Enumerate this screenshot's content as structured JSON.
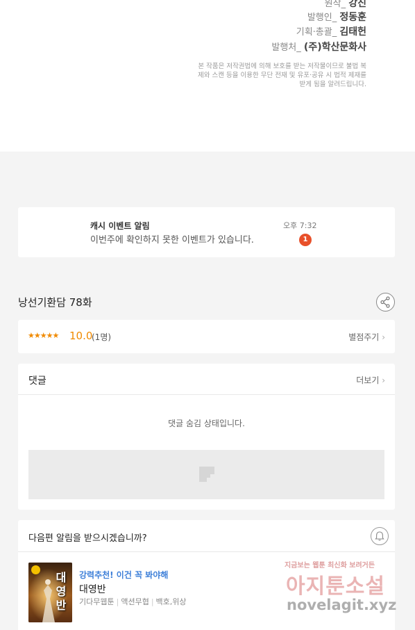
{
  "credits": {
    "items": [
      {
        "label": "원작_",
        "value": "강진"
      },
      {
        "label": "발행인_",
        "value": "정동훈"
      },
      {
        "label": "기획·총괄_",
        "value": "김태헌"
      },
      {
        "label": "발행처_",
        "value": "(주)학산문화사"
      }
    ],
    "notice": "본 작품은 저작권법에 의해 보호를 받는 저작물이므로 불법 복제와 스캔 등을 이용한 무단 전재 및 유포·공유 시 법적 제재를 받게 됨을 알려드립니다."
  },
  "alarm": {
    "title": "캐시 이벤트 알림",
    "message": "이번주에 확인하지 못한 이벤트가 있습니다.",
    "time": "오후 7:32",
    "badge": "1"
  },
  "episode": {
    "title": "낭선기환담 78화",
    "share_icon": "share-icon"
  },
  "rating": {
    "stars": "★★★★★",
    "score": "10.0",
    "count": "(1명)",
    "rate_label": "별점주기",
    "accent_color": "#f08a00"
  },
  "comments": {
    "title": "댓글",
    "more_label": "더보기",
    "hidden_message": "댓글 숨김 상태입니다."
  },
  "next_alert": {
    "question": "다음편 알림을 받으시겠습니까?",
    "bell_icon": "bell-icon"
  },
  "recommendation": {
    "tag": "강력추천! 이건 꼭 봐야해",
    "title": "대영반",
    "thumb_text": "대영반",
    "genres": [
      "기다무웹툰",
      "액션무협",
      "백호,위상"
    ],
    "tag_color": "#3d7fd8"
  },
  "watermark": {
    "top": "지금보는 웹툰 최신화 보려거든",
    "main": "아지툰소설",
    "url": "novelagit.xyz"
  }
}
